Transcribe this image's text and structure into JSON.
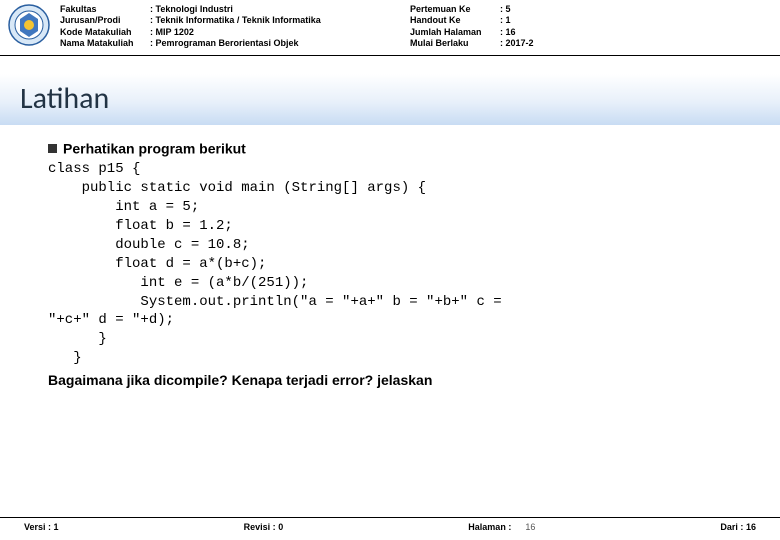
{
  "header": {
    "left_labels": [
      "Fakultas",
      "Jurusan/Prodi",
      "Kode Matakuliah",
      "Nama Matakuliah"
    ],
    "left_values": [
      ": Teknologi Industri",
      ": Teknik Informatika / Teknik Informatika",
      ": MIP 1202",
      ": Pemrograman Berorientasi Objek"
    ],
    "right_labels": [
      "Pertemuan Ke",
      "Handout Ke",
      "Jumlah Halaman",
      "Mulai Berlaku"
    ],
    "right_values": [
      ": 5",
      ": 1",
      ": 16",
      ": 2017-2"
    ]
  },
  "title": "Latihan",
  "bullet": "Perhatikan program berikut",
  "code": "class p15 {\n    public static void main (String[] args) {\n        int a = 5;\n        float b = 1.2;\n        double c = 10.8;\n        float d = a*(b+c);\n           int e = (a*b/(251));\n           System.out.println(\"a = \"+a+\" b = \"+b+\" c =\n\"+c+\" d = \"+d);\n      }\n   }",
  "question": "Bagaimana jika dicompile? Kenapa terjadi error? jelaskan",
  "footer": {
    "versi_label": "Versi :",
    "versi": "1",
    "revisi_label": "Revisi :",
    "revisi": "0",
    "halaman_label": "Halaman :",
    "halaman": "16",
    "dari_label": "Dari :",
    "dari": "16"
  }
}
